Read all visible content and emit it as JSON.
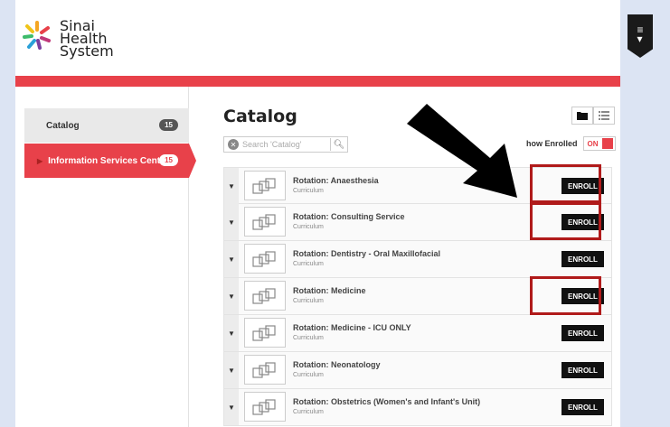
{
  "logo": {
    "line1": "Sinai",
    "line2": "Health",
    "line3": "System"
  },
  "sidebar": {
    "items": [
      {
        "label": "Catalog",
        "count": "15"
      },
      {
        "label": "Information Services Centr...",
        "count": "15"
      }
    ]
  },
  "main": {
    "title": "Catalog",
    "search_placeholder": "Search 'Catalog'",
    "show_enrolled_label": "how Enrolled",
    "toggle_label": "ON"
  },
  "rows": [
    {
      "title": "Rotation: Anaesthesia",
      "subtitle": "Curriculum",
      "button": "ENROLL"
    },
    {
      "title": "Rotation: Consulting Service",
      "subtitle": "Curriculum",
      "button": "ENROLL"
    },
    {
      "title": "Rotation: Dentistry - Oral Maxillofacial",
      "subtitle": "Curriculum",
      "button": "ENROLL"
    },
    {
      "title": "Rotation: Medicine",
      "subtitle": "Curriculum",
      "button": "ENROLL"
    },
    {
      "title": "Rotation: Medicine - ICU ONLY",
      "subtitle": "Curriculum",
      "button": "ENROLL"
    },
    {
      "title": "Rotation: Neonatology",
      "subtitle": "Curriculum",
      "button": "ENROLL"
    },
    {
      "title": "Rotation: Obstetrics (Women's and Infant's Unit)",
      "subtitle": "Curriculum",
      "button": "ENROLL"
    }
  ],
  "colors": {
    "accent": "#e8414a",
    "highlight": "#b01a1a"
  }
}
